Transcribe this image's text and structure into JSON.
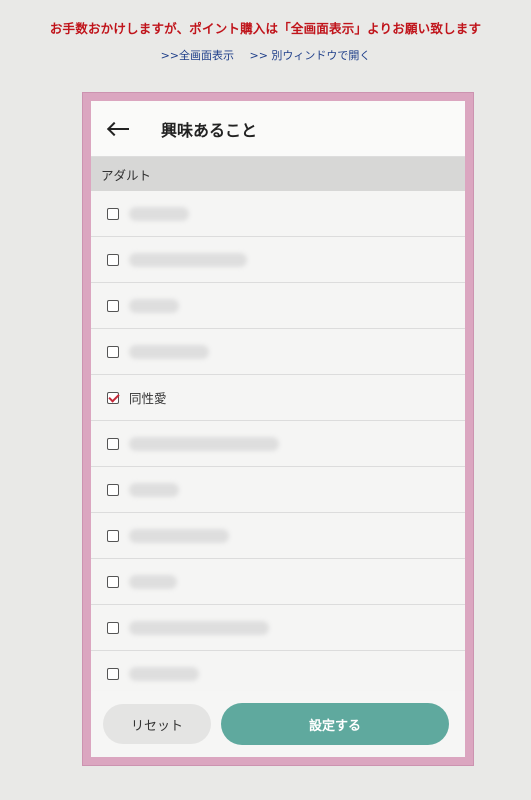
{
  "notice": "お手数おかけしますが、ポイント購入は「全画面表示」よりお願い致します",
  "links": [
    ">>全画面表示",
    ">> 別ウィンドウで開く"
  ],
  "header": {
    "title": "興味あること"
  },
  "section": {
    "label": "アダルト"
  },
  "items": [
    {
      "label": "",
      "checked": false
    },
    {
      "label": "",
      "checked": false
    },
    {
      "label": "",
      "checked": false
    },
    {
      "label": "",
      "checked": false
    },
    {
      "label": "同性愛",
      "checked": true
    },
    {
      "label": "",
      "checked": false
    },
    {
      "label": "",
      "checked": false
    },
    {
      "label": "",
      "checked": false
    },
    {
      "label": "",
      "checked": false
    },
    {
      "label": "",
      "checked": false
    },
    {
      "label": "",
      "checked": false
    }
  ],
  "buttons": {
    "reset": "リセット",
    "submit": "設定する"
  },
  "colors": {
    "frame": "#dba6c0",
    "accent": "#5fa99e",
    "notice": "#c0141b"
  }
}
